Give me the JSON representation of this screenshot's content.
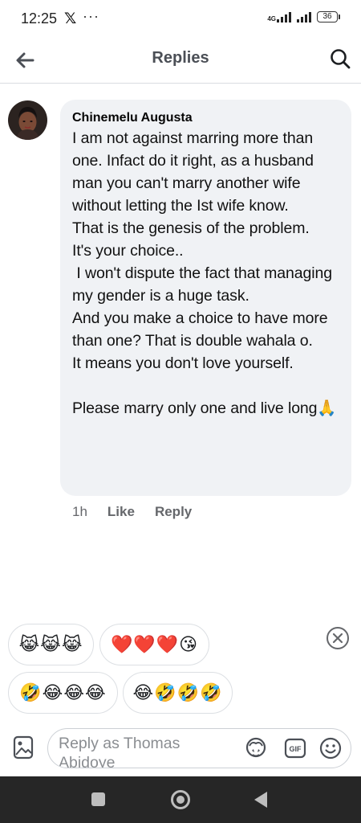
{
  "status_bar": {
    "time": "12:25",
    "x_app": "𝕏",
    "more": "···",
    "network": "4G",
    "battery": "36"
  },
  "header": {
    "title": "Replies",
    "icons": [
      "back-arrow-icon",
      "search-icon"
    ]
  },
  "comment": {
    "author": "Chinemelu Augusta",
    "text": "I am not against marring more than one. Infact do it right, as a husband man you can't marry another wife without letting the Ist wife know.\nThat is the genesis of the problem.\nIt's your choice..\n I won't dispute the fact that managing my gender is a huge task.\nAnd you make a choice to have more than one? That is double wahala o.\nIt means you don't love yourself.\n\nPlease marry only one and live long🙏",
    "time": "1h",
    "like_label": "Like",
    "reply_label": "Reply"
  },
  "reaction_chips": [
    "😹😹😹",
    "❤️❤️❤️😘",
    "🤣😂😂😂",
    "😂🤣🤣🤣"
  ],
  "composer": {
    "placeholder": "Reply as Thomas Abidoye",
    "icons": [
      "photo-icon",
      "avatar-sticker-icon",
      "gif-icon",
      "smile-icon"
    ]
  },
  "colors": {
    "bubble": "#f0f2f5",
    "secondary_text": "#65676b",
    "nav_bar": "#262626"
  }
}
